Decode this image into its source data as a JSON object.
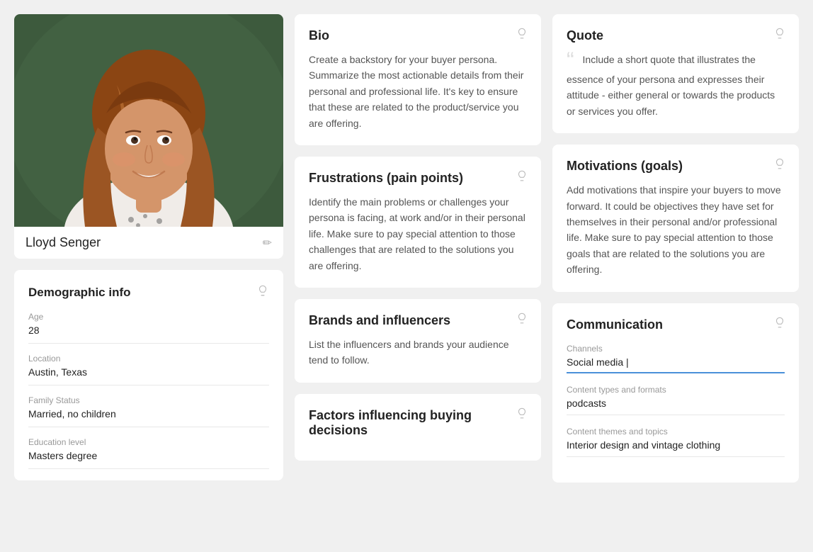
{
  "profile": {
    "name": "Lloyd Senger",
    "edit_icon": "✏",
    "bulb_icon": "💡"
  },
  "demographic": {
    "title": "Demographic info",
    "fields": [
      {
        "label": "Age",
        "value": "28"
      },
      {
        "label": "Location",
        "value": "Austin, Texas"
      },
      {
        "label": "Family Status",
        "value": "Married, no children"
      },
      {
        "label": "Education level",
        "value": "Masters degree"
      }
    ]
  },
  "cards": {
    "bio": {
      "title": "Bio",
      "body": "Create a backstory for your buyer persona. Summarize the most actionable details from their personal and professional life. It's key to ensure that these are related to the product/service you are offering."
    },
    "quote": {
      "title": "Quote",
      "body": "Include a short quote that illustrates the essence of your persona and expresses their attitude - either general or towards the products or services you offer."
    },
    "frustrations": {
      "title": "Frustrations (pain points)",
      "body": "Identify the main problems or challenges your persona is facing, at work and/or in their personal life. Make sure to pay special attention to those challenges that are related to the solutions you are offering."
    },
    "motivations": {
      "title": "Motivations (goals)",
      "body": "Add motivations that inspire your buyers to move forward. It could be objectives they have set for themselves in their personal and/or professional life. Make sure to pay special attention to those goals that are related to the solutions you are offering."
    },
    "brands": {
      "title": "Brands and influencers",
      "body": "List the influencers and brands your audience tend to follow."
    },
    "factors": {
      "title": "Factors influencing buying decisions",
      "body": ""
    }
  },
  "communication": {
    "title": "Communication",
    "channels_label": "Channels",
    "channels_value": "Social media |",
    "content_types_label": "Content types and formats",
    "content_types_value": "podcasts",
    "content_themes_label": "Content themes and topics",
    "content_themes_value": "Interior design and vintage clothing"
  }
}
